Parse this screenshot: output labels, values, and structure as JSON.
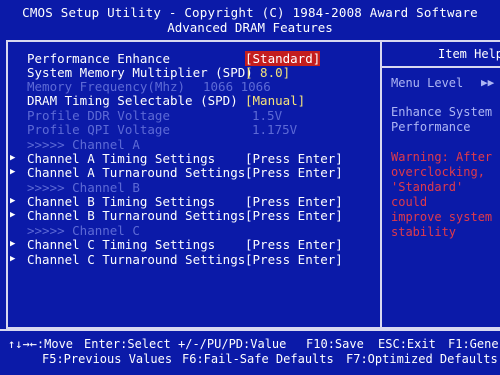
{
  "header": {
    "line1": "CMOS Setup Utility - Copyright (C) 1984-2008 Award Software",
    "line2": "Advanced DRAM Features"
  },
  "settings": [
    {
      "label": "Performance Enhance",
      "value": "[Standard]",
      "state": "selected"
    },
    {
      "label": "System Memory Multiplier (SPD)",
      "value": "[ 8.0]",
      "state": "normal"
    },
    {
      "label": "Memory Frequency(Mhz)",
      "value": "1066     1066",
      "state": "disabled"
    },
    {
      "label": "DRAM Timing Selectable   (SPD)",
      "value": "[Manual]",
      "state": "normal"
    },
    {
      "label": "Profile DDR Voltage",
      "value": "1.5V",
      "state": "disabled"
    },
    {
      "label": "Profile QPI Voltage",
      "value": "1.175V",
      "state": "disabled"
    }
  ],
  "channels": [
    {
      "section": ">>>>> Channel A",
      "items": [
        {
          "label": "Channel A Timing Settings",
          "value": "[Press Enter]"
        },
        {
          "label": "Channel A Turnaround Settings",
          "value": "[Press Enter]"
        }
      ]
    },
    {
      "section": ">>>>> Channel B",
      "items": [
        {
          "label": "Channel B Timing Settings",
          "value": "[Press Enter]"
        },
        {
          "label": "Channel B Turnaround Settings",
          "value": "[Press Enter]"
        }
      ]
    },
    {
      "section": ">>>>> Channel C",
      "items": [
        {
          "label": "Channel C Timing Settings",
          "value": "[Press Enter]"
        },
        {
          "label": "Channel C Turnaround Settings",
          "value": "[Press Enter]"
        }
      ]
    }
  ],
  "help": {
    "title": "Item Help",
    "menu_level_label": "Menu Level",
    "menu_level_arrows": "▶▶",
    "description": [
      "Enhance System",
      "Performance"
    ],
    "warning": [
      "Warning: After",
      "overclocking,",
      "'Standard' could",
      "improve system",
      "stability"
    ]
  },
  "footer": {
    "row1": [
      {
        "key": "↑↓→←",
        "action": ":Move"
      },
      {
        "key": "Enter",
        "action": ":Select"
      },
      {
        "key": "+/-/PU/PD",
        "action": ":Value"
      },
      {
        "key": "F10",
        "action": ":Save"
      },
      {
        "key": "ESC",
        "action": ":Exit"
      },
      {
        "key": "F1",
        "action": ":General Help"
      }
    ],
    "row2": [
      {
        "key": "F5",
        "action": ":Previous Values"
      },
      {
        "key": "F6",
        "action": ":Fail-Safe Defaults"
      },
      {
        "key": "F7",
        "action": ":Optimized Defaults"
      }
    ]
  },
  "colors": {
    "background": "#0b1aa8",
    "text": "#ffffff",
    "disabled": "#5d6ad6",
    "value": "#f6e37a",
    "highlight": "#c41e1e",
    "help_text": "#aeb6f4",
    "warning": "#e03a4a"
  }
}
